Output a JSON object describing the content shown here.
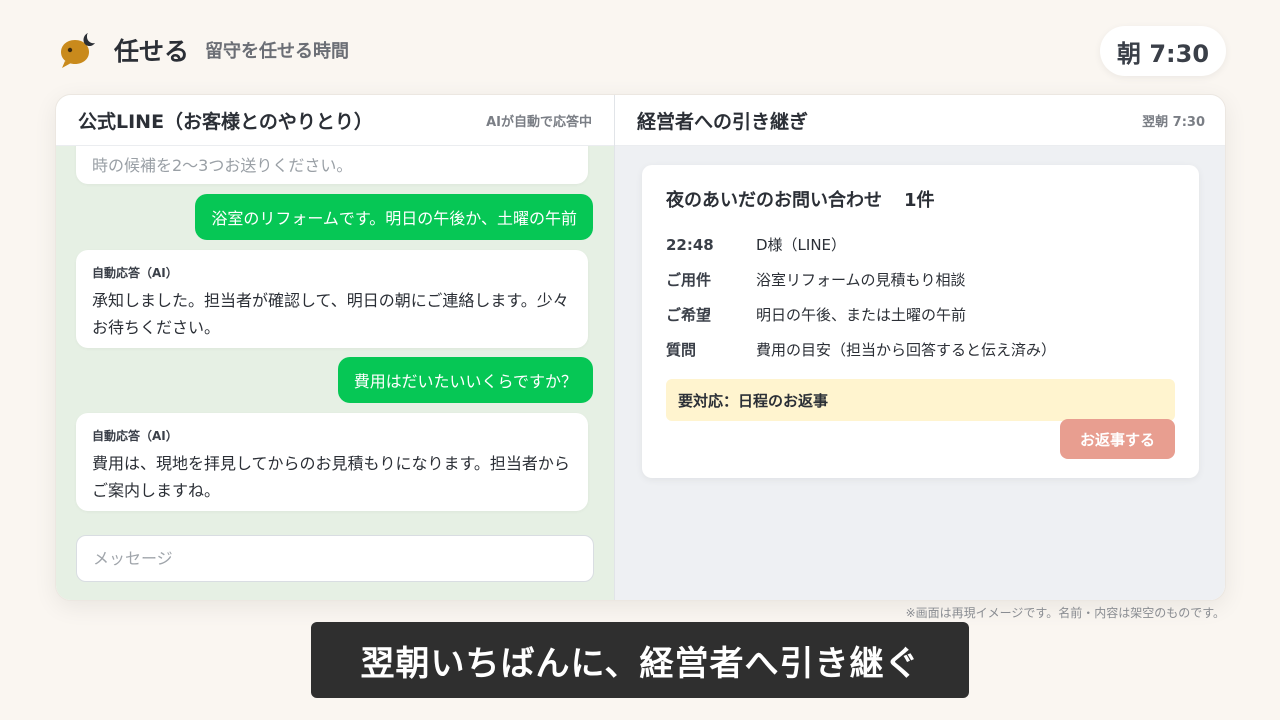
{
  "header": {
    "brand_name": "任せる",
    "brand_tagline": "留守を任せる時間",
    "clock": "朝 7:30"
  },
  "chat_panel": {
    "title": "公式LINE（お客様とのやりとり）",
    "status": "AIが自動で応答中",
    "messages": [
      {
        "from": "ai",
        "label": "",
        "text": "時の候補を2〜3つお送りください。"
      },
      {
        "from": "user",
        "text": "浴室のリフォームです。明日の午後か、土曜の午前"
      },
      {
        "from": "ai",
        "label": "自動応答（AI）",
        "text": "承知しました。担当者が確認して、明日の朝にご連絡します。少々お待ちください。"
      },
      {
        "from": "user",
        "text": "費用はだいたいいくらですか？"
      },
      {
        "from": "ai",
        "label": "自動応答（AI）",
        "text": "費用は、現地を拝見してからのお見積もりになります。担当者からご案内しますね。"
      }
    ],
    "input_placeholder": "メッセージ"
  },
  "handoff_panel": {
    "title": "経営者への引き継ぎ",
    "timestamp": "翌朝 7:30",
    "card": {
      "title": "夜のあいだのお問い合わせ",
      "count": "1件",
      "rows": [
        {
          "key": "22:48",
          "value": "D様（LINE）"
        },
        {
          "key": "ご用件",
          "value": "浴室リフォームの見積もり相談"
        },
        {
          "key": "ご希望",
          "value": "明日の午後、または土曜の午前"
        },
        {
          "key": "質問",
          "value": "費用の目安（担当から回答すると伝え済み）"
        }
      ],
      "alert": "要対応：日程のお返事",
      "reply_button": "お返事する"
    }
  },
  "disclaimer": "※画面は再現イメージです。名前・内容は架空のものです。",
  "caption": "翌朝いちばんに、経営者へ引き継ぐ",
  "colors": {
    "line_green": "#06c755",
    "reply_button": "#e89e90",
    "alert_bg": "#fff4cf",
    "logo": "#c98a1c"
  }
}
